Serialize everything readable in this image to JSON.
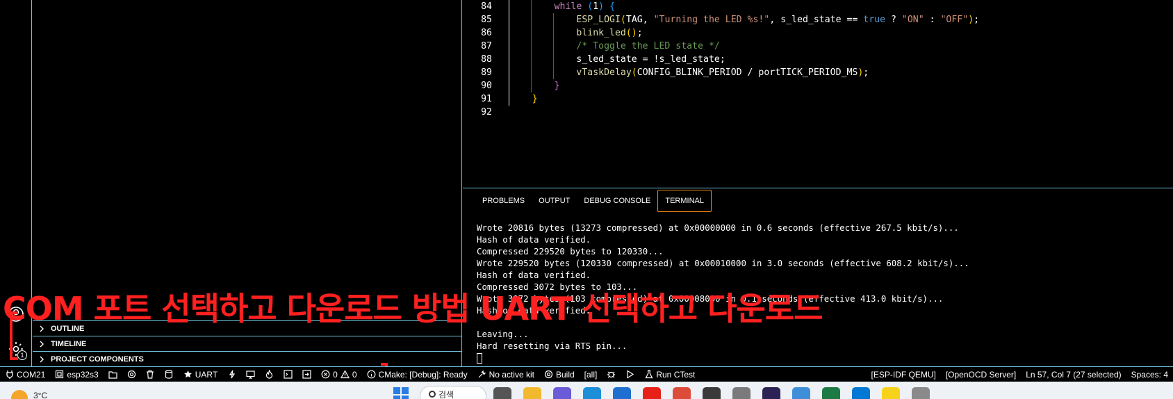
{
  "editor": {
    "lines": [
      {
        "num": "84",
        "indent": 2,
        "tokens": [
          {
            "t": "while",
            "c": "kw-ctrl"
          },
          {
            "t": " ",
            "c": "plain"
          },
          {
            "t": "(",
            "c": "br3"
          },
          {
            "t": "1",
            "c": "plain"
          },
          {
            "t": ")",
            "c": "br3"
          },
          {
            "t": " ",
            "c": "plain"
          },
          {
            "t": "{",
            "c": "br3"
          }
        ]
      },
      {
        "num": "85",
        "indent": 3,
        "tokens": [
          {
            "t": "ESP_LOGI",
            "c": "fn"
          },
          {
            "t": "(",
            "c": "br1"
          },
          {
            "t": "TAG, ",
            "c": "plain"
          },
          {
            "t": "\"Turning the LED %s!\"",
            "c": "str"
          },
          {
            "t": ", s_led_state == ",
            "c": "plain"
          },
          {
            "t": "true",
            "c": "kw"
          },
          {
            "t": " ? ",
            "c": "plain"
          },
          {
            "t": "\"ON\"",
            "c": "str"
          },
          {
            "t": " : ",
            "c": "plain"
          },
          {
            "t": "\"OFF\"",
            "c": "str"
          },
          {
            "t": ")",
            "c": "br1"
          },
          {
            "t": ";",
            "c": "plain"
          }
        ]
      },
      {
        "num": "86",
        "indent": 3,
        "tokens": [
          {
            "t": "blink_led",
            "c": "fn"
          },
          {
            "t": "()",
            "c": "br1"
          },
          {
            "t": ";",
            "c": "plain"
          }
        ]
      },
      {
        "num": "87",
        "indent": 3,
        "tokens": [
          {
            "t": "/* Toggle the LED state */",
            "c": "com"
          }
        ]
      },
      {
        "num": "88",
        "indent": 3,
        "tokens": [
          {
            "t": "s_led_state = !s_led_state;",
            "c": "plain"
          }
        ]
      },
      {
        "num": "89",
        "indent": 3,
        "tokens": [
          {
            "t": "vTaskDelay",
            "c": "fn"
          },
          {
            "t": "(",
            "c": "br1"
          },
          {
            "t": "CONFIG_BLINK_PERIOD / portTICK_PERIOD_MS",
            "c": "plain"
          },
          {
            "t": ")",
            "c": "br1"
          },
          {
            "t": ";",
            "c": "plain"
          }
        ]
      },
      {
        "num": "90",
        "indent": 2,
        "tokens": [
          {
            "t": "}",
            "c": "br2"
          }
        ]
      },
      {
        "num": "91",
        "indent": 1,
        "tokens": [
          {
            "t": "}",
            "c": "br1"
          }
        ]
      },
      {
        "num": "92",
        "indent": 0,
        "tokens": []
      }
    ]
  },
  "panel": {
    "tabs": [
      {
        "label": "PROBLEMS",
        "active": false
      },
      {
        "label": "OUTPUT",
        "active": false
      },
      {
        "label": "DEBUG CONSOLE",
        "active": false
      },
      {
        "label": "TERMINAL",
        "active": true
      }
    ],
    "terminal_lines": [
      "Wrote 20816 bytes (13273 compressed) at 0x00000000 in 0.6 seconds (effective 267.5 kbit/s)...",
      "Hash of data verified.",
      "Compressed 229520 bytes to 120330...",
      "Wrote 229520 bytes (120330 compressed) at 0x00010000 in 3.0 seconds (effective 608.2 kbit/s)...",
      "Hash of data verified.",
      "Compressed 3072 bytes to 103...",
      "Wrote 3072 bytes (103 compressed) at 0x00008000 in 0.1 seconds (effective 413.0 kbit/s)...",
      "Hash of data verified.",
      "",
      "Leaving...",
      "Hard resetting via RTS pin..."
    ]
  },
  "sidebar": {
    "sections": [
      "OUTLINE",
      "TIMELINE",
      "PROJECT COMPONENTS"
    ]
  },
  "activity": {
    "manage_badge": "1"
  },
  "annotation": {
    "text": "COM 포트 선택하고 다운로드 방법 UART 선택하고 다운로드"
  },
  "statusbar": {
    "port": "COM21",
    "target": "esp32s3",
    "flash_method": "UART",
    "errors": "0",
    "warnings": "0",
    "cmake": "CMake: [Debug]: Ready",
    "kit": "No active kit",
    "build": "Build",
    "build_target": "[all]",
    "run_ctest": "Run CTest",
    "qemu": "[ESP-IDF QEMU]",
    "openocd": "[OpenOCD Server]",
    "position": "Ln 57, Col 7 (27 selected)",
    "spaces": "Spaces: 4"
  },
  "taskbar": {
    "temperature": "3°C",
    "search_placeholder": "검색",
    "apps": [
      {
        "name": "task-view",
        "color": "#555555"
      },
      {
        "name": "file-explorer",
        "color": "#f2b92e"
      },
      {
        "name": "copilot",
        "color": "#6b5bd6"
      },
      {
        "name": "edge",
        "color": "#1c8fd8"
      },
      {
        "name": "store",
        "color": "#1f6fd0"
      },
      {
        "name": "youtube",
        "color": "#e62117"
      },
      {
        "name": "chrome",
        "color": "#dd4b39"
      },
      {
        "name": "terminal",
        "color": "#3a3a3a"
      },
      {
        "name": "tool",
        "color": "#7a7a7a"
      },
      {
        "name": "eclipse",
        "color": "#2c2255"
      },
      {
        "name": "notepad",
        "color": "#3f8fd8"
      },
      {
        "name": "excel",
        "color": "#1d7a45"
      },
      {
        "name": "vscode",
        "color": "#0078d4"
      },
      {
        "name": "kakaotalk",
        "color": "#f7d21b"
      },
      {
        "name": "misc",
        "color": "#8a8a8a"
      }
    ]
  }
}
